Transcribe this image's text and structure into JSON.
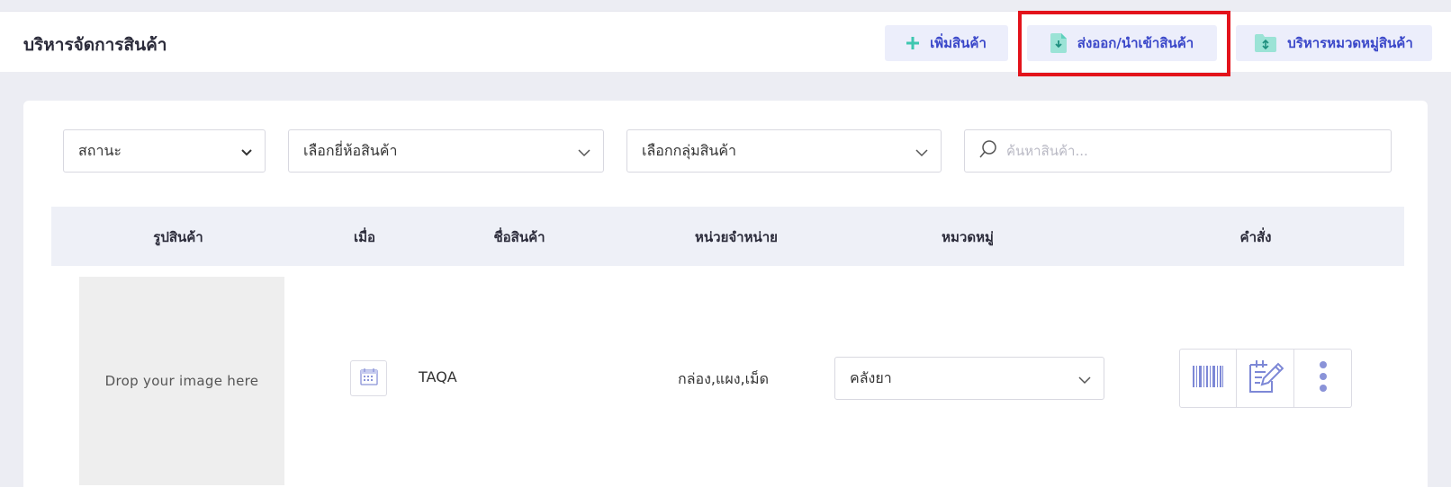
{
  "header": {
    "title": "บริหารจัดการสินค้า",
    "buttons": {
      "add": "เพิ่มสินค้า",
      "import_export": "ส่งออก/นำเข้าสินค้า",
      "manage_categories": "บริหารหมวดหมู่สินค้า"
    }
  },
  "filters": {
    "status": "สถานะ",
    "brand": "เลือกยี่ห้อสินค้า",
    "group": "เลือกกลุ่มสินค้า",
    "search_placeholder": "ค้นหาสินค้า..."
  },
  "table": {
    "columns": [
      "รูปสินค้า",
      "เมื่อ",
      "ชื่อสินค้า",
      "หน่วยจำหน่าย",
      "หมวดหมู่",
      "คำสั่ง"
    ],
    "rows": [
      {
        "image_text": "Drop your image here",
        "name": "TAQA",
        "units": "กล่อง,แผง,เม็ด",
        "category": "คลังยา"
      }
    ]
  },
  "colors": {
    "accent": "#3a47c9",
    "button_bg": "#eceefb",
    "highlight": "#e3131b",
    "icon_teal": "#3ec7b0",
    "icon_purple": "#7d88d6"
  },
  "icons": {
    "add": "plus-icon",
    "import_export": "file-download-icon",
    "categories": "folder-icon",
    "search": "search-icon",
    "date": "calendar-icon",
    "barcode": "barcode-icon",
    "edit": "edit-note-icon",
    "more": "more-vertical-icon"
  }
}
